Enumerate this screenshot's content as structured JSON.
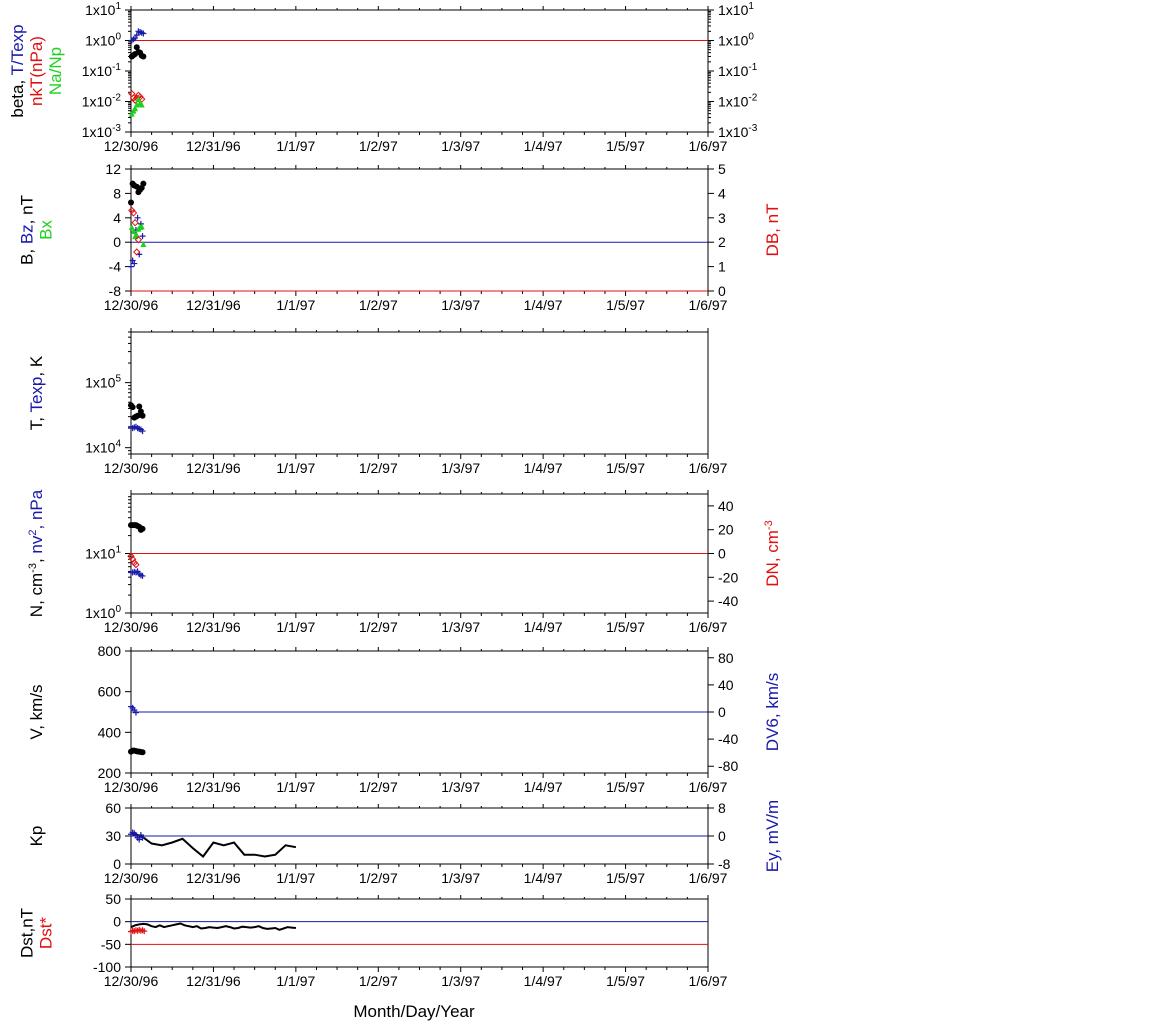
{
  "colors": {
    "black": "#000000",
    "blue": "#1a1aa8",
    "red": "#e01010",
    "green": "#20d020"
  },
  "xlabel": "Month/Day/Year",
  "xticks": [
    "12/30/96",
    "12/31/96",
    "1/1/97",
    "1/2/97",
    "1/3/97",
    "1/4/97",
    "1/5/97",
    "1/6/97"
  ],
  "chart_data": [
    {
      "type": "scatter",
      "id": "beta",
      "left_label_lines": [
        [
          {
            "text": "beta, ",
            "color": "black"
          },
          {
            "text": "T/Texp",
            "color": "blue"
          }
        ],
        [
          {
            "text": "nkT(nPa)",
            "color": "red"
          }
        ],
        [
          {
            "text": "Na/Np",
            "color": "green"
          }
        ]
      ],
      "yscale": "log",
      "ylim": [
        0.001,
        10
      ],
      "yticks_left": [
        {
          "b": "1x10",
          "e": "-3"
        },
        {
          "b": "1x10",
          "e": "-2"
        },
        {
          "b": "1x10",
          "e": "-1"
        },
        {
          "b": "1x10",
          "e": "0"
        },
        {
          "b": "1x10",
          "e": "1"
        }
      ],
      "yticks_right": [
        {
          "b": "1x10",
          "e": "-3"
        },
        {
          "b": "1x10",
          "e": "-2"
        },
        {
          "b": "1x10",
          "e": "-1"
        },
        {
          "b": "1x10",
          "e": "0"
        },
        {
          "b": "1x10",
          "e": "1"
        }
      ],
      "hlines": [
        {
          "y": 1,
          "color": "red"
        }
      ],
      "series": [
        {
          "marker": "dot",
          "color": "black",
          "x": [
            0.01,
            0.03,
            0.05,
            0.07,
            0.09,
            0.11,
            0.13,
            0.15
          ],
          "y": [
            0.3,
            0.33,
            0.36,
            0.6,
            0.42,
            0.4,
            0.32,
            0.3
          ]
        },
        {
          "marker": "plus",
          "color": "blue",
          "x": [
            0.01,
            0.03,
            0.05,
            0.07,
            0.09,
            0.11,
            0.13,
            0.15
          ],
          "y": [
            1.0,
            1.1,
            1.2,
            1.5,
            2.0,
            1.9,
            1.8,
            1.7
          ]
        },
        {
          "marker": "diamond",
          "color": "red",
          "x": [
            0.01,
            0.03,
            0.05,
            0.07,
            0.09,
            0.11,
            0.13
          ],
          "y": [
            0.018,
            0.013,
            0.011,
            0.013,
            0.016,
            0.014,
            0.012
          ]
        },
        {
          "marker": "tri",
          "color": "green",
          "x": [
            0.01,
            0.03,
            0.05,
            0.07,
            0.09,
            0.11,
            0.13
          ],
          "y": [
            0.004,
            0.005,
            0.006,
            0.008,
            0.012,
            0.009,
            0.008
          ]
        }
      ]
    },
    {
      "type": "scatter",
      "id": "bfield",
      "left_label_lines": [
        [
          {
            "text": "B, ",
            "color": "black"
          },
          {
            "text": "Bz",
            "color": "blue"
          },
          {
            "text": ", nT",
            "color": "black"
          }
        ],
        [
          {
            "text": "Bx",
            "color": "green"
          }
        ]
      ],
      "right_label_lines": [
        [
          {
            "text": "DB, nT",
            "color": "red"
          }
        ]
      ],
      "yscale": "linear",
      "ylim": [
        -8,
        12
      ],
      "ylim_right": [
        0,
        5
      ],
      "yticks_left": [
        {
          "b": "-8"
        },
        {
          "b": "-4"
        },
        {
          "b": "0"
        },
        {
          "b": "4"
        },
        {
          "b": "8"
        },
        {
          "b": "12"
        }
      ],
      "yticks_right": [
        {
          "b": "0"
        },
        {
          "b": "1"
        },
        {
          "b": "2"
        },
        {
          "b": "3"
        },
        {
          "b": "4"
        },
        {
          "b": "5"
        }
      ],
      "hlines": [
        {
          "y": 0,
          "color": "blue"
        },
        {
          "y": -8,
          "color": "red"
        }
      ],
      "series": [
        {
          "marker": "dot",
          "color": "black",
          "x": [
            0.0,
            0.02,
            0.04,
            0.07,
            0.09,
            0.11,
            0.13,
            0.15
          ],
          "y": [
            6.5,
            9.6,
            9.3,
            9.1,
            8.2,
            8.6,
            8.9,
            9.6
          ]
        },
        {
          "marker": "plus",
          "color": "blue",
          "x": [
            0.0,
            0.02,
            0.04,
            0.06,
            0.08,
            0.1,
            0.12,
            0.14
          ],
          "y": [
            -4,
            -3,
            -3.5,
            2,
            4,
            -2,
            3,
            1
          ]
        },
        {
          "marker": "tri",
          "color": "green",
          "x": [
            0.01,
            0.03,
            0.05,
            0.07,
            0.09,
            0.11,
            0.13,
            0.15
          ],
          "y": [
            2.5,
            1.8,
            1.0,
            1.2,
            2.2,
            2.5,
            2.6,
            -0.3
          ]
        },
        {
          "marker": "diamond",
          "color": "red",
          "axis": "right",
          "x": [
            0.01,
            0.03,
            0.05,
            0.07,
            0.09
          ],
          "y": [
            3.3,
            3.2,
            2.8,
            1.6,
            2.1
          ]
        }
      ]
    },
    {
      "type": "scatter",
      "id": "temp",
      "left_label_lines": [
        [
          {
            "text": "T, ",
            "color": "black"
          },
          {
            "text": "Texp",
            "color": "blue"
          },
          {
            "text": ", K",
            "color": "black"
          }
        ]
      ],
      "yscale": "log",
      "ylim": [
        8000,
        600000
      ],
      "yticks_left": [
        {
          "b": "1x10",
          "e": "4"
        },
        {
          "b": "1x10",
          "e": "5"
        }
      ],
      "series": [
        {
          "marker": "dot",
          "color": "black",
          "x": [
            0.0,
            0.02,
            0.04,
            0.06,
            0.08,
            0.1,
            0.12,
            0.14
          ],
          "y": [
            45000,
            42000,
            29000,
            30000,
            31000,
            43000,
            36000,
            31000
          ]
        },
        {
          "marker": "plus",
          "color": "blue",
          "x": [
            0.0,
            0.02,
            0.04,
            0.06,
            0.08,
            0.1,
            0.12,
            0.14
          ],
          "y": [
            21000,
            20000,
            20500,
            21000,
            20000,
            19500,
            19000,
            18000
          ]
        }
      ]
    },
    {
      "type": "scatter",
      "id": "density",
      "left_label_lines": [
        [
          {
            "text": "N, cm",
            "color": "black"
          },
          {
            "text": "-3",
            "color": "black",
            "sup": true
          },
          {
            "text": ", ",
            "color": "black"
          },
          {
            "text": "nv",
            "color": "blue"
          },
          {
            "text": "2",
            "color": "blue",
            "sup": true
          },
          {
            "text": ", nPa",
            "color": "blue"
          }
        ]
      ],
      "right_label_lines": [
        [
          {
            "text": "DN, cm",
            "color": "red"
          },
          {
            "text": "-3",
            "color": "red",
            "sup": true
          }
        ]
      ],
      "yscale": "log",
      "ylim": [
        1,
        100
      ],
      "ylim_right": [
        -50,
        50
      ],
      "yticks_left": [
        {
          "b": "1x10",
          "e": "0"
        },
        {
          "b": "1x10",
          "e": "1"
        }
      ],
      "yticks_right": [
        {
          "b": "-40"
        },
        {
          "b": "-20"
        },
        {
          "b": "0"
        },
        {
          "b": "20"
        },
        {
          "b": "40"
        }
      ],
      "hlines": [
        {
          "y": 0,
          "color": "red",
          "axis": "right"
        }
      ],
      "series": [
        {
          "marker": "dot",
          "color": "black",
          "x": [
            0.0,
            0.02,
            0.04,
            0.06,
            0.08,
            0.1,
            0.12,
            0.14
          ],
          "y": [
            30,
            30,
            30,
            30,
            29,
            28,
            25,
            26
          ]
        },
        {
          "marker": "diamond",
          "color": "red",
          "x": [
            0.0,
            0.02,
            0.04,
            0.06
          ],
          "y": [
            9,
            8,
            7,
            6.5
          ]
        },
        {
          "marker": "plus",
          "color": "blue",
          "x": [
            0.0,
            0.02,
            0.04,
            0.06,
            0.08,
            0.1,
            0.12,
            0.14
          ],
          "y": [
            4.8,
            4.8,
            4.9,
            4.8,
            5.0,
            4.5,
            4.3,
            4.2
          ]
        }
      ]
    },
    {
      "type": "scatter",
      "id": "velocity",
      "left_label_lines": [
        [
          {
            "text": "V, km/s",
            "color": "black"
          }
        ]
      ],
      "right_label_lines": [
        [
          {
            "text": "DV6, km/s",
            "color": "blue"
          }
        ]
      ],
      "yscale": "linear",
      "ylim": [
        200,
        800
      ],
      "ylim_right": [
        -90,
        90
      ],
      "yticks_left": [
        {
          "b": "200"
        },
        {
          "b": "400"
        },
        {
          "b": "600"
        },
        {
          "b": "800"
        }
      ],
      "yticks_right": [
        {
          "b": "-80"
        },
        {
          "b": "-40"
        },
        {
          "b": "0"
        },
        {
          "b": "40"
        },
        {
          "b": "80"
        }
      ],
      "hlines": [
        {
          "y": 0,
          "color": "blue",
          "axis": "right"
        }
      ],
      "series": [
        {
          "marker": "dot",
          "color": "black",
          "x": [
            0.0,
            0.02,
            0.04,
            0.06,
            0.08,
            0.1,
            0.12,
            0.14
          ],
          "y": [
            305,
            310,
            310,
            308,
            306,
            305,
            303,
            302
          ]
        },
        {
          "marker": "plus",
          "color": "blue",
          "axis": "right",
          "x": [
            0.0,
            0.02,
            0.04,
            0.06
          ],
          "y": [
            8,
            6,
            3,
            -1
          ]
        }
      ]
    },
    {
      "type": "line",
      "id": "kp",
      "left_label_lines": [
        [
          {
            "text": "Kp",
            "color": "black"
          }
        ]
      ],
      "right_label_lines": [
        [
          {
            "text": "Ey,  mV/m",
            "color": "blue"
          }
        ]
      ],
      "yscale": "linear",
      "ylim": [
        0,
        60
      ],
      "ylim_right": [
        -8,
        8
      ],
      "yticks_left": [
        {
          "b": "0"
        },
        {
          "b": "30"
        },
        {
          "b": "60"
        }
      ],
      "yticks_right": [
        {
          "b": "-8"
        },
        {
          "b": "0"
        },
        {
          "b": "8"
        }
      ],
      "hlines": [
        {
          "y": 0,
          "color": "blue",
          "axis": "right"
        }
      ],
      "series": [
        {
          "marker": "line",
          "color": "black",
          "x": [
            0,
            0.125,
            0.25,
            0.375,
            0.5,
            0.625,
            0.75,
            0.875,
            1.0,
            1.125,
            1.25,
            1.375,
            1.5,
            1.625,
            1.75,
            1.875,
            2.0
          ],
          "y": [
            33,
            30,
            22,
            20,
            23,
            27,
            17,
            8,
            23,
            20,
            23,
            10,
            10,
            8,
            10,
            20,
            18
          ]
        },
        {
          "marker": "plus",
          "color": "blue",
          "axis": "right",
          "x": [
            0.0,
            0.02,
            0.04,
            0.06,
            0.08,
            0.1,
            0.12,
            0.14
          ],
          "y": [
            0.5,
            1.0,
            0.8,
            0.2,
            -0.5,
            -1.0,
            0.3,
            -0.5
          ]
        }
      ]
    },
    {
      "type": "line",
      "id": "dst",
      "left_label_lines": [
        [
          {
            "text": "Dst,nT",
            "color": "black"
          }
        ],
        [
          {
            "text": "Dst*",
            "color": "red"
          }
        ]
      ],
      "yscale": "linear",
      "ylim": [
        -100,
        50
      ],
      "yticks_left": [
        {
          "b": "-100"
        },
        {
          "b": "-50"
        },
        {
          "b": "0"
        },
        {
          "b": "50"
        }
      ],
      "hlines": [
        {
          "y": 0,
          "color": "blue"
        },
        {
          "y": -50,
          "color": "red"
        }
      ],
      "series": [
        {
          "marker": "line",
          "color": "black",
          "x": [
            0.0,
            0.05,
            0.1,
            0.15,
            0.2,
            0.25,
            0.3,
            0.35,
            0.4,
            0.45,
            0.5,
            0.55,
            0.6,
            0.65,
            0.7,
            0.75,
            0.8,
            0.85,
            0.9,
            0.95,
            1.0,
            1.05,
            1.1,
            1.15,
            1.2,
            1.25,
            1.3,
            1.35,
            1.4,
            1.45,
            1.5,
            1.55,
            1.6,
            1.65,
            1.7,
            1.75,
            1.8,
            1.85,
            1.9,
            1.95,
            2.0
          ],
          "y": [
            -12,
            -8,
            -6,
            -5,
            -6,
            -10,
            -12,
            -8,
            -12,
            -10,
            -8,
            -6,
            -4,
            -8,
            -10,
            -12,
            -10,
            -15,
            -14,
            -12,
            -13,
            -14,
            -12,
            -10,
            -12,
            -15,
            -14,
            -11,
            -12,
            -13,
            -12,
            -10,
            -14,
            -16,
            -15,
            -14,
            -18,
            -15,
            -12,
            -13,
            -14
          ]
        },
        {
          "marker": "plus",
          "color": "red",
          "x": [
            0.0,
            0.02,
            0.04,
            0.06,
            0.08,
            0.1,
            0.12,
            0.14,
            0.16
          ],
          "y": [
            -22,
            -20,
            -21,
            -19,
            -20,
            -18,
            -20,
            -19,
            -21
          ]
        }
      ]
    }
  ]
}
